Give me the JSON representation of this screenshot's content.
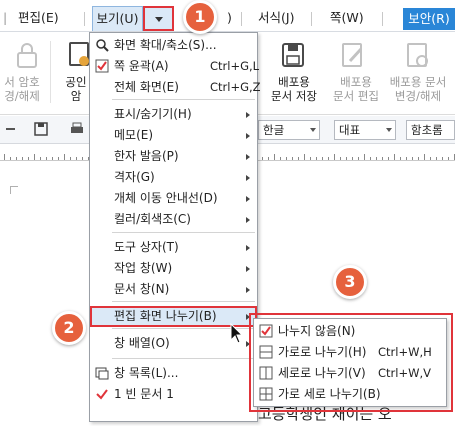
{
  "menubar": {
    "items": [
      {
        "label": "편집(E)"
      },
      {
        "label": "보기(U)"
      },
      {
        "label": ")"
      },
      {
        "label": "서식(J)"
      },
      {
        "label": "쪽(W)"
      }
    ],
    "security_label": "보안(R)"
  },
  "ribbon": {
    "items": [
      {
        "label": "서 암호\n경/해제"
      },
      {
        "label": "공인\n암"
      },
      {
        "label": "배포용\n문서 저장"
      },
      {
        "label": "배포용\n문서 편집"
      },
      {
        "label": "배포용 문서\n변경/해제"
      }
    ]
  },
  "format_bar": {
    "font_lang": "한글",
    "font_name": "대표",
    "font_face": "함초롬"
  },
  "view_menu": {
    "items": [
      {
        "label": "화면 확대/축소(S)...",
        "shortcut": "",
        "icon": "zoom-icon",
        "submenu": false
      },
      {
        "label": "쪽 윤곽(A)",
        "shortcut": "Ctrl+G,L",
        "icon": "checkbox-checked-icon",
        "submenu": false
      },
      {
        "label": "전체 화면(E)",
        "shortcut": "Ctrl+G,Z",
        "icon": "",
        "submenu": false
      },
      {
        "label": "표시/숨기기(H)",
        "shortcut": "",
        "icon": "",
        "submenu": true
      },
      {
        "label": "메모(E)",
        "shortcut": "",
        "icon": "",
        "submenu": true
      },
      {
        "label": "한자 발음(P)",
        "shortcut": "",
        "icon": "",
        "submenu": true
      },
      {
        "label": "격자(G)",
        "shortcut": "",
        "icon": "",
        "submenu": true
      },
      {
        "label": "개체 이동 안내선(D)",
        "shortcut": "",
        "icon": "",
        "submenu": true
      },
      {
        "label": "컬러/회색조(C)",
        "shortcut": "",
        "icon": "",
        "submenu": true
      },
      {
        "label": "도구 상자(T)",
        "shortcut": "",
        "icon": "",
        "submenu": true
      },
      {
        "label": "작업 창(W)",
        "shortcut": "",
        "icon": "",
        "submenu": true
      },
      {
        "label": "문서 창(N)",
        "shortcut": "",
        "icon": "",
        "submenu": true
      },
      {
        "label": "편집 화면 나누기(B)",
        "shortcut": "",
        "icon": "",
        "submenu": true
      },
      {
        "label": "창 배열(O)",
        "shortcut": "",
        "icon": "",
        "submenu": true
      },
      {
        "label": "창 목록(L)...",
        "shortcut": "",
        "icon": "window-list-icon",
        "submenu": false
      },
      {
        "label": "1 빈 문서 1",
        "shortcut": "",
        "icon": "checkmark-icon",
        "submenu": false
      }
    ]
  },
  "split_submenu": {
    "items": [
      {
        "label": "나누지 않음(N)",
        "shortcut": "",
        "icon": "checkbox-checked-icon"
      },
      {
        "label": "가로로 나누기(H)",
        "shortcut": "Ctrl+W,H",
        "icon": "split-horizontal-icon"
      },
      {
        "label": "세로로 나누기(V)",
        "shortcut": "Ctrl+W,V",
        "icon": "split-vertical-icon"
      },
      {
        "label": "가로 세로 나누기(B)",
        "shortcut": "",
        "icon": "split-grid-icon"
      }
    ]
  },
  "badges": [
    "1",
    "2",
    "3"
  ],
  "document": {
    "visible_text": "고등학생인 재이는 오"
  },
  "colors": {
    "accent_red": "#e0343a",
    "badge_orange": "#e6613d",
    "security_blue": "#2a86d7",
    "highlight": "#dbe9f7"
  }
}
